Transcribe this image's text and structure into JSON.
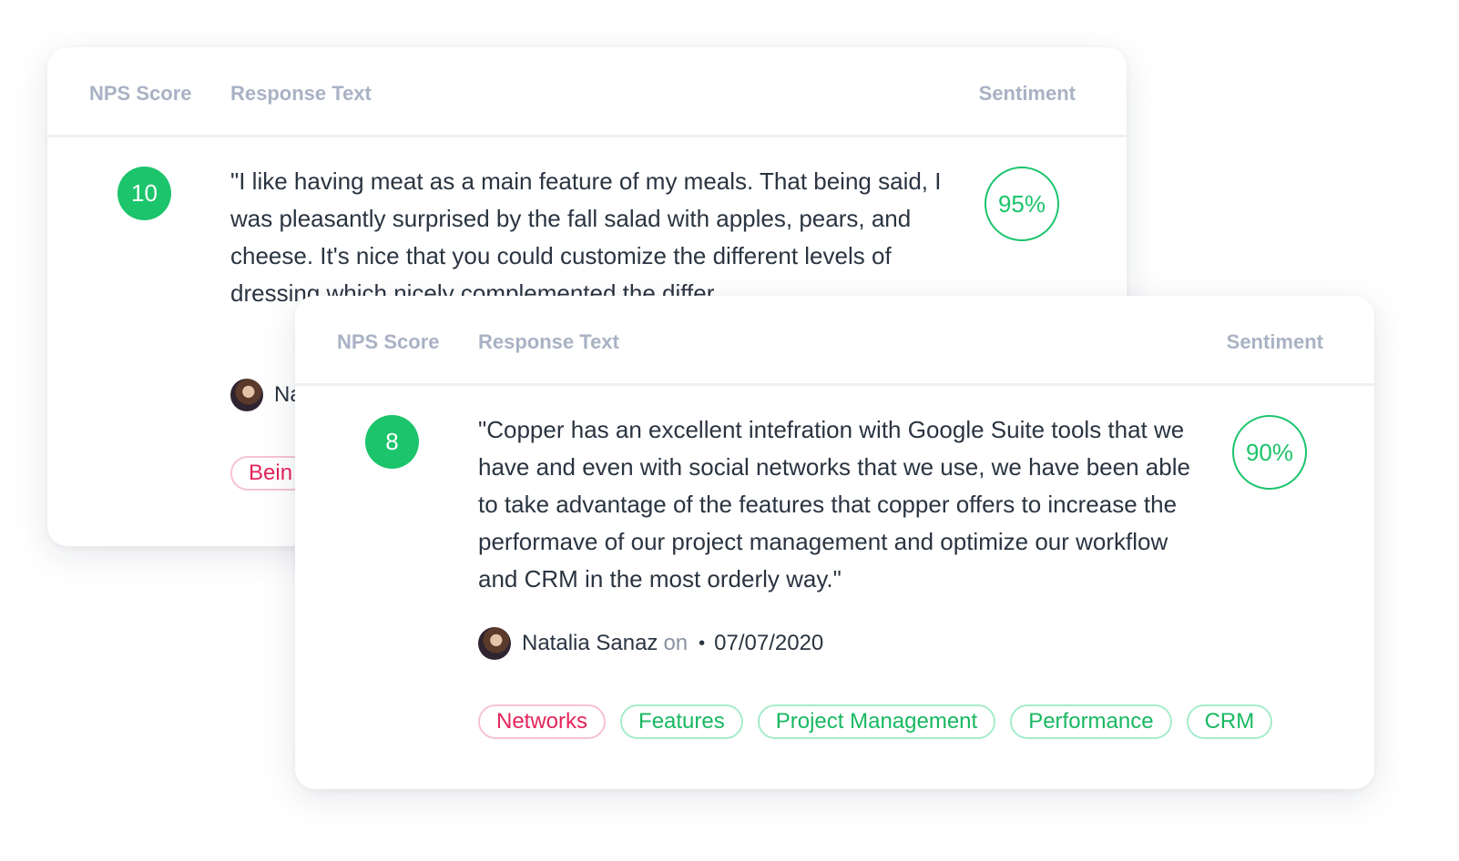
{
  "colors": {
    "positive": "#1cc46b",
    "negative": "#e4245a",
    "header_text": "#a9b2c4",
    "body_text": "#2a3441"
  },
  "back_card": {
    "headers": {
      "nps": "NPS Score",
      "response": "Response Text",
      "sentiment": "Sentiment"
    },
    "score": "10",
    "sentiment": "95%",
    "response": "\"I like having meat as a main feature of my meals. That being said, I was pleasantly surprised by the fall salad with apples, pears, and cheese. It's nice that you could customize the different levels of dressing which nicely complemented the differ",
    "author_visible": "Na",
    "tags": [
      {
        "label": "Bein",
        "tone": "negative"
      }
    ]
  },
  "front_card": {
    "headers": {
      "nps": "NPS Score",
      "response": "Response Text",
      "sentiment": "Sentiment"
    },
    "score": "8",
    "sentiment": "90%",
    "response": "\"Copper has an excellent intefration with Google Suite tools that we have and even with social networks that we use, we have been able to take advantage of the features that copper offers to increase the performave of our project management and optimize our workflow and CRM in the most orderly way.\"",
    "author": {
      "name": "Natalia Sanaz",
      "on_label": "on",
      "separator": "•",
      "date": "07/07/2020"
    },
    "tags": [
      {
        "label": "Networks",
        "tone": "negative"
      },
      {
        "label": "Features",
        "tone": "positive"
      },
      {
        "label": "Project Management",
        "tone": "positive"
      },
      {
        "label": "Performance",
        "tone": "positive"
      },
      {
        "label": "CRM",
        "tone": "positive"
      }
    ]
  }
}
